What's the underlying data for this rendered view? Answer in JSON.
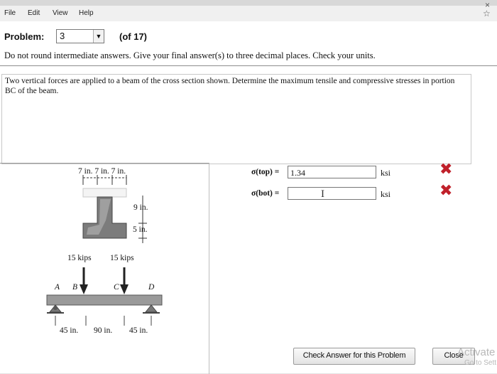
{
  "menu": {
    "file": "File",
    "edit": "Edit",
    "view": "View",
    "help": "Help"
  },
  "icons": {
    "star": "star-icon",
    "close": "close-icon",
    "dropdown": "chevron-down-icon",
    "cursor": "text-cursor-icon",
    "incorrect": "x-mark-icon"
  },
  "problem": {
    "label": "Problem:",
    "selected": "3",
    "count": "(of 17)",
    "instructions": "Do not round intermediate answers. Give your final answer(s) to three decimal places. Check your units.",
    "question": "Two vertical forces are applied to a beam of the cross section shown. Determine the maximum tensile and compressive stresses in portion BC of the beam."
  },
  "figure": {
    "top_dims": "7 in. 7 in. 7 in.",
    "dim_9": "9 in.",
    "dim_5": "5 in.",
    "load1": "15 kips",
    "load2": "15 kips",
    "pt_a": "A",
    "pt_b": "B",
    "pt_c": "C",
    "pt_d": "D",
    "span1": "45 in.",
    "span2": "90 in.",
    "span3": "45 in."
  },
  "answers": {
    "top_label": "σ(top) =",
    "top_value": "1.34",
    "top_unit": "ksi",
    "bot_label": "σ(bot) =",
    "bot_value": "",
    "bot_unit": "ksi",
    "cursor": "I"
  },
  "buttons": {
    "check": "Check Answer for this Problem",
    "close": "Close"
  },
  "watermark": {
    "line1": "Activate",
    "line2": "Go to Sett"
  },
  "colors": {
    "incorrect": "#c0202a",
    "beam": "#9a9a9a",
    "background": "#ffffff"
  }
}
